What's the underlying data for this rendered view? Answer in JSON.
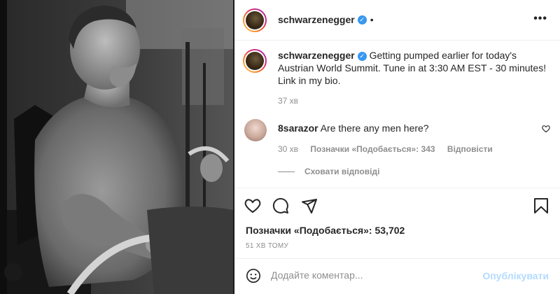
{
  "post": {
    "username": "schwarzenegger",
    "verified_mark": "✓",
    "separator": "•",
    "more_label": "•••",
    "caption": "Getting pumped earlier for today's Austrian World Summit. Tune in at 3:30 AM EST - 30 minutes! Link in my bio.",
    "caption_time": "37 хв"
  },
  "comment": {
    "username": "8sarazor",
    "text": "Are there any men here?",
    "time": "30 хв",
    "likes": "Позначки «Подобається»: 343",
    "reply": "Відповісти",
    "hide_replies": "Сховати відповіді"
  },
  "footer": {
    "likes": "Позначки «Подобається»: 53,702",
    "ago": "51 ХВ ТОМУ",
    "comment_placeholder": "Додайте коментар...",
    "publish": "Опублікувати"
  },
  "icons": [
    "heart-icon",
    "comment-icon",
    "share-icon",
    "bookmark-icon",
    "emoji-icon",
    "more-icon"
  ],
  "colors": {
    "accent": "#3897f0",
    "publish_disabled": "#b3dbff",
    "meta": "#8e8e8e"
  }
}
